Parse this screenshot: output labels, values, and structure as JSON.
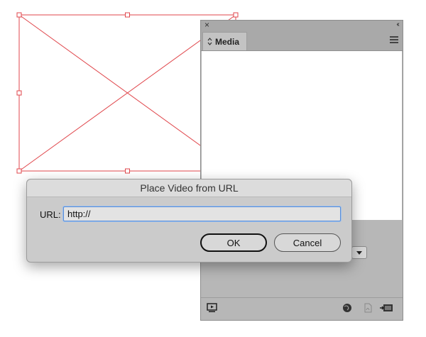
{
  "media_panel": {
    "close_glyph": "×",
    "collapse_glyph": "‹‹",
    "tab_label": "Media",
    "icons": {
      "menu": "hamburger-menu-icon",
      "preview": "video-preview-icon",
      "web": "globe-icon",
      "pdf": "pdf-icon",
      "place": "place-video-icon"
    }
  },
  "dialog": {
    "title": "Place Video from URL",
    "url_label": "URL:",
    "url_value": "http://",
    "ok_label": "OK",
    "cancel_label": "Cancel"
  },
  "colors": {
    "frame_stroke": "#e0464b",
    "focus_ring": "#5a8dd6"
  }
}
